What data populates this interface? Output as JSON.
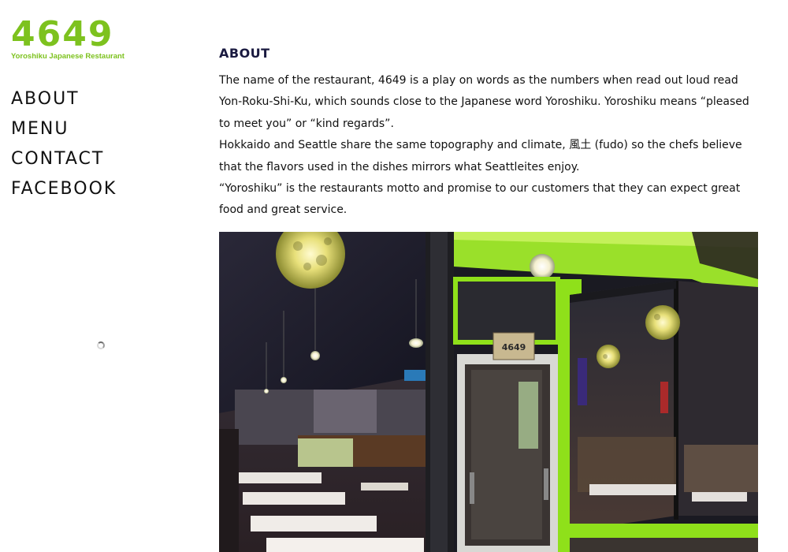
{
  "logo": {
    "number": "4649",
    "subtitle": "Yoroshiku Japanese Restaurant",
    "color": "#7dc21e"
  },
  "nav": {
    "items": [
      {
        "label": "ABOUT"
      },
      {
        "label": "MENU"
      },
      {
        "label": "CONTACT"
      },
      {
        "label": "FACEBOOK"
      }
    ]
  },
  "about": {
    "heading": "ABOUT",
    "paragraphs": [
      "The name of the restaurant, 4649 is a play on words as the numbers when read out loud read Yon-Roku-Shi-Ku, which sounds close to the Japanese word Yoroshiku. Yoroshiku means “pleased to meet you” or “kind regards”.",
      "Hokkaido and Seattle share the same topography and climate, 風土 (fudo) so the chefs believe that the flavors used in the dishes mirrors what Seattleites enjoy.",
      "“Yoroshiku” is the restaurants motto and promise to our customers that they can expect great food and great service."
    ]
  },
  "photo": {
    "sign_text": "4649",
    "accent": "#8fe01a"
  },
  "spinner": {
    "icon": "loading-spinner-icon"
  }
}
